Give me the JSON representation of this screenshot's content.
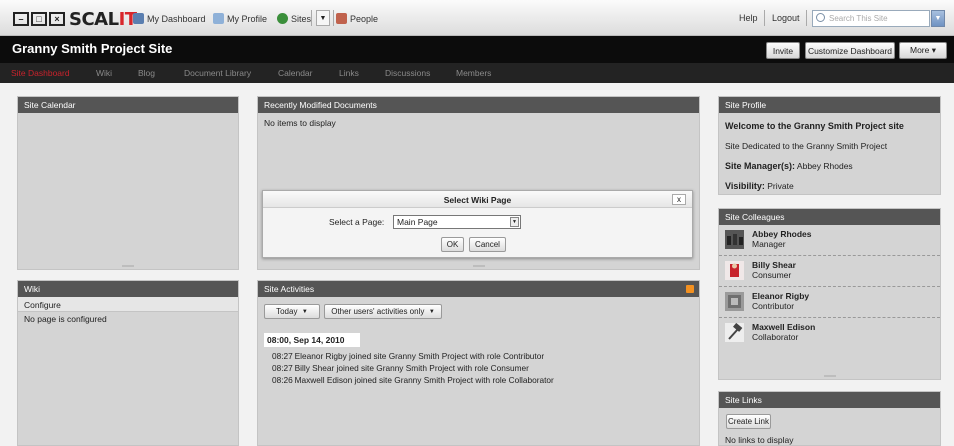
{
  "topbar": {
    "logo_text": "SCALIT",
    "my_dashboard": "My Dashboard",
    "my_profile": "My Profile",
    "sites": "Sites",
    "people": "People",
    "help": "Help",
    "logout": "Logout",
    "search_placeholder": "Search This Site"
  },
  "site": {
    "title": "Granny Smith Project Site",
    "invite": "Invite",
    "customize": "Customize Dashboard",
    "more": "More ▾"
  },
  "nav": {
    "tabs": [
      "Site Dashboard",
      "Wiki",
      "Blog",
      "Document Library",
      "Calendar",
      "Links",
      "Discussions",
      "Members"
    ]
  },
  "calendar": {
    "title": "Site Calendar"
  },
  "docs": {
    "title": "Recently Modified Documents",
    "empty": "No items to display"
  },
  "wiki": {
    "title": "Wiki",
    "configure": "Configure",
    "empty": "No page is configured"
  },
  "activities": {
    "title": "Site Activities",
    "filter_today": "Today",
    "filter_other": "Other users' activities only",
    "date": "08:00, Sep 14, 2010",
    "rows": [
      {
        "time": "08:27",
        "text": "Eleanor Rigby joined site Granny Smith Project with role Contributor"
      },
      {
        "time": "08:27",
        "text": "Billy Shear joined site Granny Smith Project with role Consumer"
      },
      {
        "time": "08:26",
        "text": "Maxwell Edison joined site Granny Smith Project with role Collaborator"
      }
    ]
  },
  "profile": {
    "title": "Site Profile",
    "welcome": "Welcome to the Granny Smith Project site",
    "description": "Site Dedicated to the Granny Smith Project",
    "manager_label": "Site Manager(s):",
    "manager": "Abbey Rhodes",
    "visibility_label": "Visibility:",
    "visibility": "Private"
  },
  "colleagues": {
    "title": "Site Colleagues",
    "people": [
      {
        "name": "Abbey Rhodes",
        "role": "Manager"
      },
      {
        "name": "Billy Shear",
        "role": "Consumer"
      },
      {
        "name": "Eleanor Rigby",
        "role": "Contributor"
      },
      {
        "name": "Maxwell Edison",
        "role": "Collaborator"
      }
    ]
  },
  "links": {
    "title": "Site Links",
    "create": "Create Link",
    "empty": "No links to display"
  },
  "modal": {
    "title": "Select Wiki Page",
    "label": "Select a Page:",
    "selected": "Main Page",
    "ok": "OK",
    "cancel": "Cancel",
    "close": "x"
  }
}
